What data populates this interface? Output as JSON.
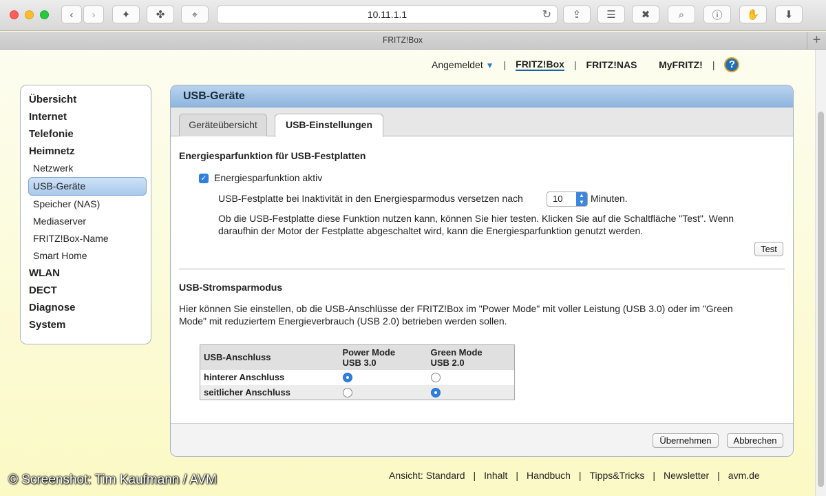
{
  "browser": {
    "url": "10.11.1.1",
    "tab_title": "FRITZ!Box",
    "icons": [
      "back-icon",
      "forward-icon",
      "tool-icon",
      "wifi-icon",
      "pin-icon",
      "reload-icon",
      "share-icon",
      "layers-icon",
      "x-icon",
      "search-icon",
      "info-icon",
      "hand-icon",
      "download-icon",
      "plus-icon"
    ],
    "traffic_colors": [
      "#fc5f57",
      "#fdbc2e",
      "#28c840"
    ]
  },
  "topnav": {
    "user": "Angemeldet",
    "items": [
      "FRITZ!Box",
      "FRITZ!NAS",
      "MyFRITZ!"
    ],
    "active": "FRITZ!Box",
    "help": "?"
  },
  "sidebar": {
    "items": [
      {
        "label": "Übersicht",
        "level": "main"
      },
      {
        "label": "Internet",
        "level": "main"
      },
      {
        "label": "Telefonie",
        "level": "main"
      },
      {
        "label": "Heimnetz",
        "level": "main"
      },
      {
        "label": "Netzwerk",
        "level": "sub"
      },
      {
        "label": "USB-Geräte",
        "level": "sub",
        "selected": true
      },
      {
        "label": "Speicher (NAS)",
        "level": "sub"
      },
      {
        "label": "Mediaserver",
        "level": "sub"
      },
      {
        "label": "FRITZ!Box-Name",
        "level": "sub"
      },
      {
        "label": "Smart Home",
        "level": "sub"
      },
      {
        "label": "WLAN",
        "level": "main"
      },
      {
        "label": "DECT",
        "level": "main"
      },
      {
        "label": "Diagnose",
        "level": "main"
      },
      {
        "label": "System",
        "level": "main"
      }
    ]
  },
  "panel": {
    "title": "USB-Geräte",
    "tabs": [
      "Geräteübersicht",
      "USB-Einstellungen"
    ],
    "active_tab": "USB-Einstellungen",
    "energy": {
      "title": "Energiesparfunktion für USB-Festplatten",
      "checkbox_label": "Energiesparfunktion aktiv",
      "checked": true,
      "timeout_prefix": "USB-Festplatte bei Inaktivität in den Energiesparmodus versetzen nach",
      "timeout_value": "10",
      "timeout_suffix": "Minuten.",
      "info_line1": "Ob die USB-Festplatte diese Funktion nutzen kann, können Sie hier testen. Klicken Sie auf die Schaltfläche \"Test\". Wenn",
      "info_line2": "daraufhin der Motor der Festplatte abgeschaltet wird, kann die Energiesparfunktion genutzt werden.",
      "test_button": "Test"
    },
    "power": {
      "title": "USB-Stromsparmodus",
      "desc_line1": "Hier können Sie einstellen, ob die USB-Anschlüsse der FRITZ!Box im \"Power Mode\" mit voller Leistung (USB 3.0) oder im \"Green",
      "desc_line2": "Mode\" mit reduziertem Energieverbrauch (USB 2.0) betrieben werden sollen.",
      "table": {
        "col0": "USB-Anschluss",
        "col1_line1": "Power Mode",
        "col1_line2": "USB 3.0",
        "col2_line1": "Green Mode",
        "col2_line2": "USB 2.0",
        "rows": [
          {
            "label": "hinterer Anschluss",
            "selected": "power"
          },
          {
            "label": "seitlicher Anschluss",
            "selected": "green"
          }
        ]
      }
    },
    "buttons": {
      "apply": "Übernehmen",
      "cancel": "Abbrechen"
    }
  },
  "footer": {
    "items": [
      "Ansicht: Standard",
      "Inhalt",
      "Handbuch",
      "Tipps&Tricks",
      "Newsletter",
      "avm.de"
    ]
  },
  "watermark": "© Screenshot: Tim Kaufmann / AVM"
}
